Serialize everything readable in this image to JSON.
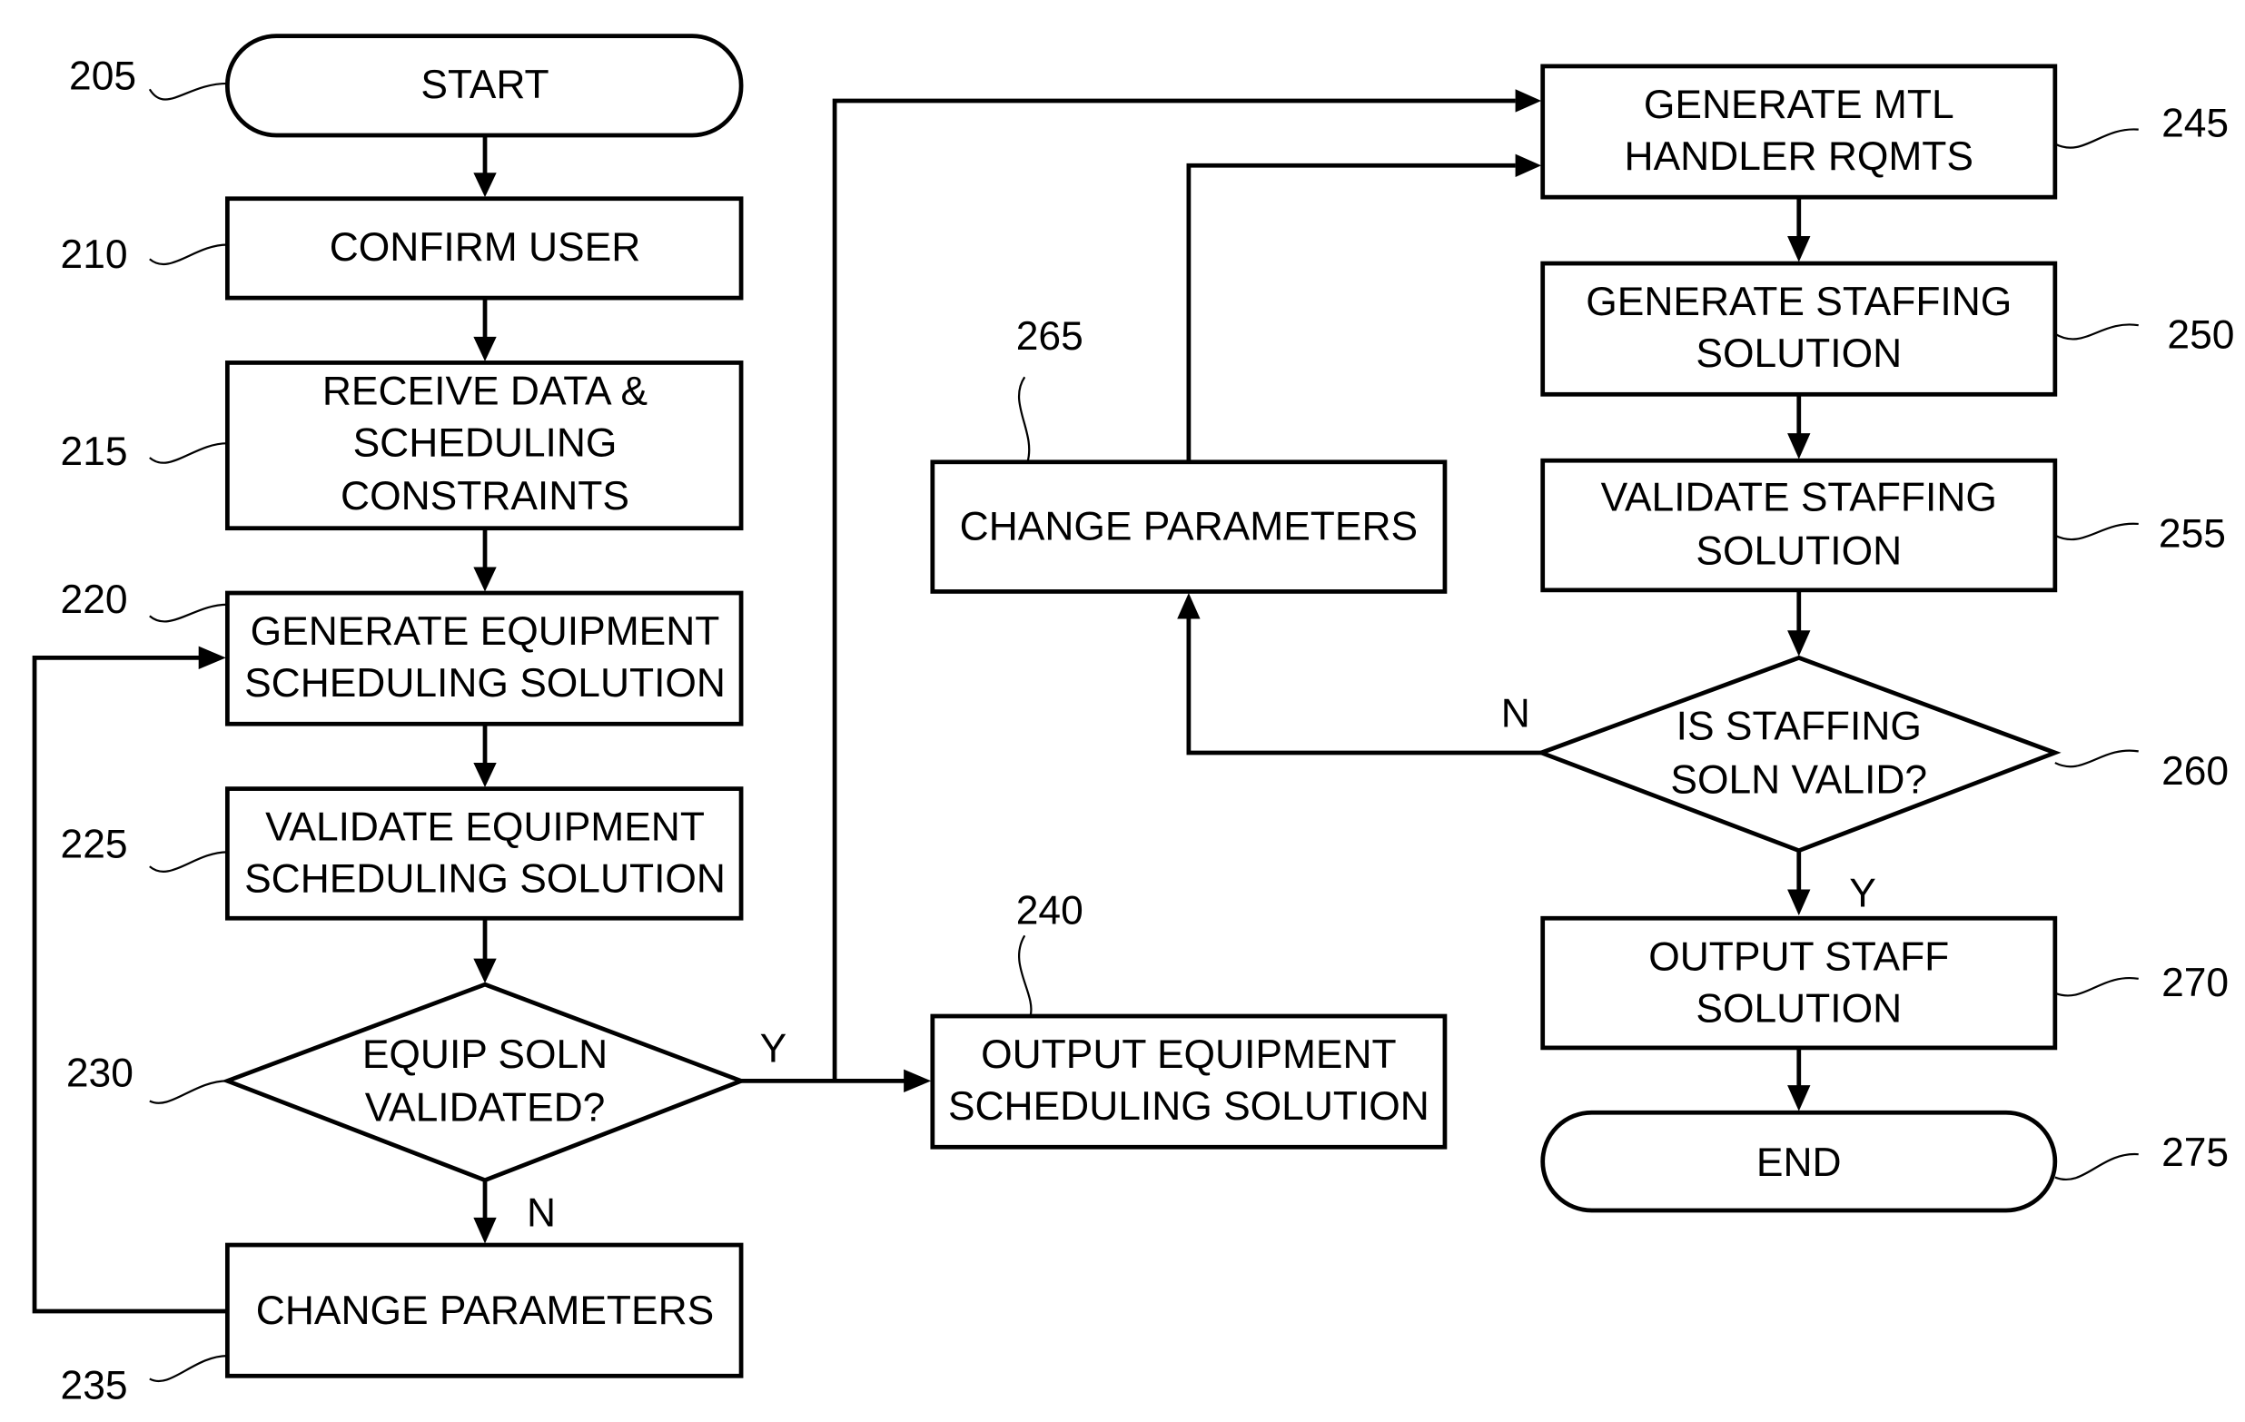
{
  "diagram": {
    "type": "flowchart",
    "nodes": {
      "n205": {
        "ref": "205",
        "shape": "terminal",
        "lines": [
          "START"
        ]
      },
      "n210": {
        "ref": "210",
        "shape": "process",
        "lines": [
          "CONFIRM USER"
        ]
      },
      "n215": {
        "ref": "215",
        "shape": "process",
        "lines": [
          "RECEIVE DATA &",
          "SCHEDULING",
          "CONSTRAINTS"
        ]
      },
      "n220": {
        "ref": "220",
        "shape": "process",
        "lines": [
          "GENERATE EQUIPMENT",
          "SCHEDULING SOLUTION"
        ]
      },
      "n225": {
        "ref": "225",
        "shape": "process",
        "lines": [
          "VALIDATE EQUIPMENT",
          "SCHEDULING SOLUTION"
        ]
      },
      "n230": {
        "ref": "230",
        "shape": "decision",
        "lines": [
          "EQUIP SOLN",
          "VALIDATED?"
        ]
      },
      "n235": {
        "ref": "235",
        "shape": "process",
        "lines": [
          "CHANGE PARAMETERS"
        ]
      },
      "n240": {
        "ref": "240",
        "shape": "process",
        "lines": [
          "OUTPUT EQUIPMENT",
          "SCHEDULING SOLUTION"
        ]
      },
      "n245": {
        "ref": "245",
        "shape": "process",
        "lines": [
          "GENERATE MTL",
          "HANDLER RQMTS"
        ]
      },
      "n250": {
        "ref": "250",
        "shape": "process",
        "lines": [
          "GENERATE STAFFING",
          "SOLUTION"
        ]
      },
      "n255": {
        "ref": "255",
        "shape": "process",
        "lines": [
          "VALIDATE STAFFING",
          "SOLUTION"
        ]
      },
      "n260": {
        "ref": "260",
        "shape": "decision",
        "lines": [
          "IS STAFFING",
          "SOLN VALID?"
        ]
      },
      "n265": {
        "ref": "265",
        "shape": "process",
        "lines": [
          "CHANGE PARAMETERS"
        ]
      },
      "n270": {
        "ref": "270",
        "shape": "process",
        "lines": [
          "OUTPUT STAFF",
          "SOLUTION"
        ]
      },
      "n275": {
        "ref": "275",
        "shape": "terminal",
        "lines": [
          "END"
        ]
      }
    },
    "edges": [
      {
        "from": "205",
        "to": "210",
        "label": ""
      },
      {
        "from": "210",
        "to": "215",
        "label": ""
      },
      {
        "from": "215",
        "to": "220",
        "label": ""
      },
      {
        "from": "220",
        "to": "225",
        "label": ""
      },
      {
        "from": "225",
        "to": "230",
        "label": ""
      },
      {
        "from": "230",
        "to": "235",
        "label": "N"
      },
      {
        "from": "235",
        "to": "220",
        "label": ""
      },
      {
        "from": "230",
        "to": "240",
        "label": "Y"
      },
      {
        "from": "230",
        "to": "245",
        "label": "Y"
      },
      {
        "from": "245",
        "to": "250",
        "label": ""
      },
      {
        "from": "250",
        "to": "255",
        "label": ""
      },
      {
        "from": "255",
        "to": "260",
        "label": ""
      },
      {
        "from": "260",
        "to": "265",
        "label": "N"
      },
      {
        "from": "265",
        "to": "245",
        "label": ""
      },
      {
        "from": "260",
        "to": "270",
        "label": "Y"
      },
      {
        "from": "270",
        "to": "275",
        "label": ""
      }
    ],
    "labels": {
      "y230": "Y",
      "n230": "N",
      "n260": "N",
      "y260": "Y"
    }
  }
}
